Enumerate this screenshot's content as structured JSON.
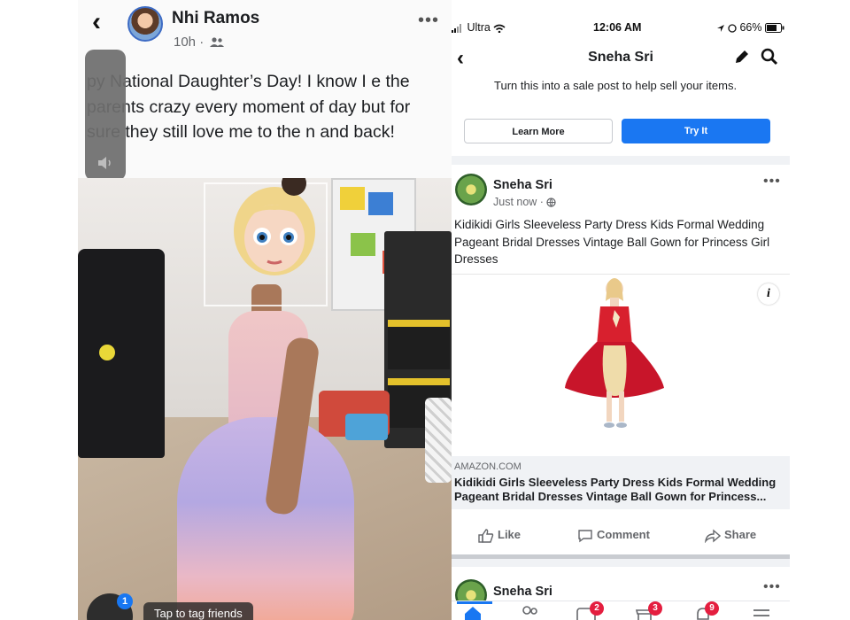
{
  "left_post": {
    "author": "Nhi Ramos",
    "time": "10h ·",
    "caption": "py National Daughter’s Day!  I know I e the parents crazy every moment of day but for sure they still love me to the n and back!",
    "tag_hint": "Tap to tag friends",
    "tag_badge": "1",
    "icons": [
      "back-chevron-icon",
      "friends-icon",
      "more-dots-icon",
      "volume-icon"
    ]
  },
  "status_bar": {
    "carrier": "Ultra",
    "time": "12:06 AM",
    "battery": "66%"
  },
  "right_nav": {
    "title": "Sneha Sri",
    "icons": [
      "back-chevron-icon",
      "pencil-icon",
      "search-icon"
    ]
  },
  "promo": {
    "text": "Turn this into a sale post to help sell your items.",
    "learn_more": "Learn More",
    "try_it": "Try It"
  },
  "post": {
    "author": "Sneha Sri",
    "time": "Just now ·",
    "text": "Kidikidi Girls Sleeveless Party Dress Kids Formal Wedding Pageant Bridal Dresses Vintage Ball Gown for Princess Girl Dresses",
    "link_domain": "AMAZON.COM",
    "link_title": "Kidikidi Girls Sleeveless Party Dress Kids Formal Wedding Pageant Bridal Dresses Vintage Ball Gown for Princess...",
    "like": "Like",
    "comment": "Comment",
    "share": "Share"
  },
  "next_post": {
    "author": "Sneha Sri"
  },
  "tab_bar": {
    "badges": [
      "2",
      "3",
      "9"
    ],
    "icons": [
      "home-icon",
      "friends-icon",
      "watch-icon",
      "marketplace-icon",
      "notifications-icon",
      "menu-icon"
    ]
  },
  "colors": {
    "facebook_blue": "#1877f2",
    "badge_red": "#e41e3f"
  }
}
